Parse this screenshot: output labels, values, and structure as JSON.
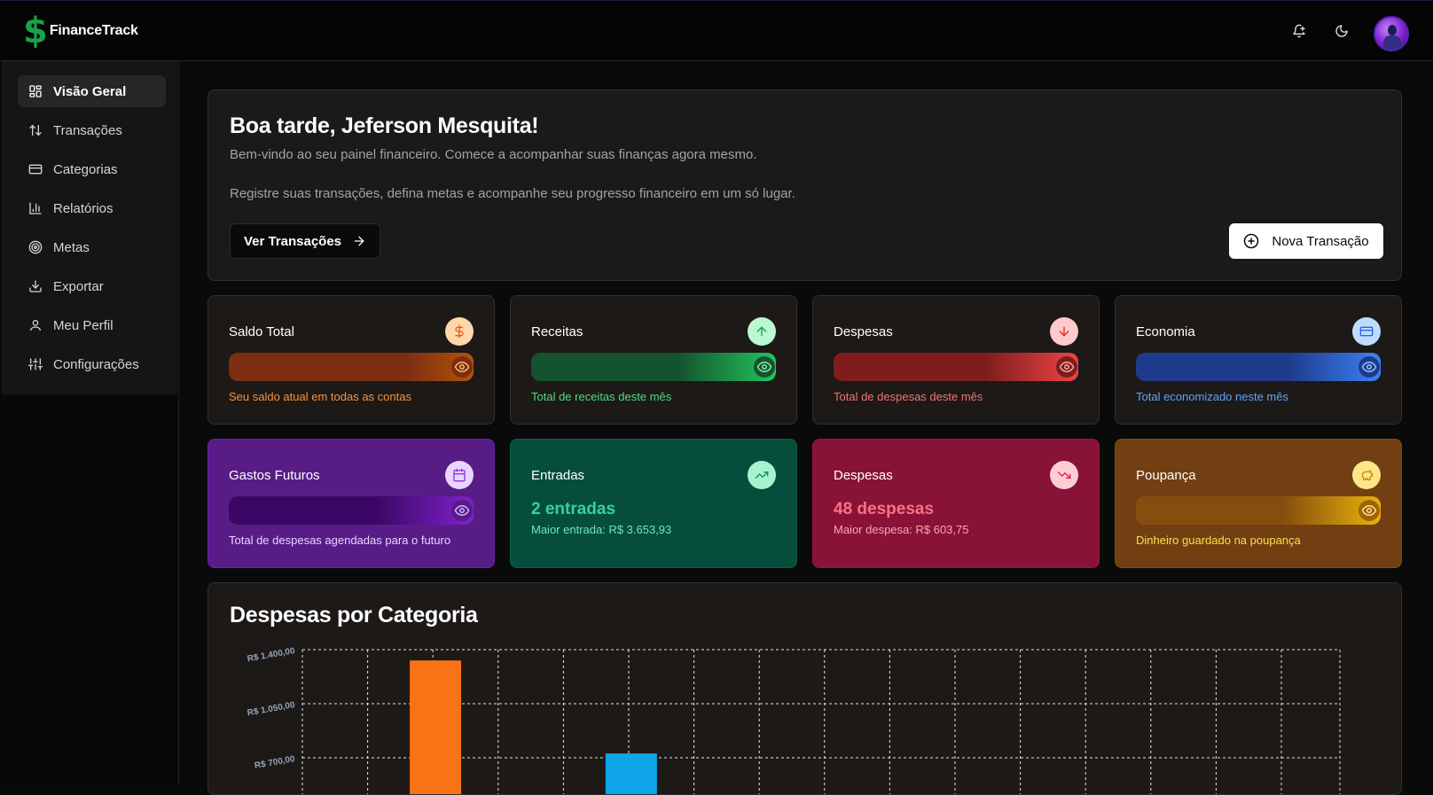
{
  "app": {
    "logo_symbol": "$",
    "name": "FinanceTrack",
    "brand_color": "#16a34a"
  },
  "topbar": {
    "icons": [
      "bell-plus-icon",
      "moon-icon"
    ],
    "avatar": "user-avatar"
  },
  "sidebar": {
    "items": [
      {
        "label": "Visão Geral",
        "icon": "dashboard-icon",
        "active": true
      },
      {
        "label": "Transações",
        "icon": "arrows-up-down-icon",
        "active": false
      },
      {
        "label": "Categorias",
        "icon": "card-icon",
        "active": false
      },
      {
        "label": "Relatórios",
        "icon": "bar-chart-icon",
        "active": false
      },
      {
        "label": "Metas",
        "icon": "target-icon",
        "active": false
      },
      {
        "label": "Exportar",
        "icon": "download-icon",
        "active": false
      },
      {
        "label": "Meu Perfil",
        "icon": "user-icon",
        "active": false
      },
      {
        "label": "Configurações",
        "icon": "sliders-icon",
        "active": false
      }
    ]
  },
  "hero": {
    "greeting": "Boa tarde, Jeferson Mesquita!",
    "line1": "Bem-vindo ao seu painel financeiro. Comece a acompanhar suas finanças agora mesmo.",
    "line2": "Registre suas transações, defina metas e acompanhe seu progresso financeiro em um só lugar.",
    "primary_button": "Ver Transações",
    "secondary_button": "Nova Transação"
  },
  "cards_row1": [
    {
      "title": "Saldo Total",
      "icon": "dollar-icon",
      "desc": "Seu saldo atual em todas as contas"
    },
    {
      "title": "Receitas",
      "icon": "arrow-up-icon",
      "desc": "Total de receitas deste mês"
    },
    {
      "title": "Despesas",
      "icon": "arrow-down-icon",
      "desc": "Total de despesas deste mês"
    },
    {
      "title": "Economia",
      "icon": "credit-card-icon",
      "desc": "Total economizado neste mês"
    }
  ],
  "cards_row2": [
    {
      "title": "Gastos Futuros",
      "icon": "calendar-icon",
      "desc": "Total de despesas agendadas para o futuro"
    },
    {
      "title": "Entradas",
      "icon": "trending-up-icon",
      "big": "2 entradas",
      "sub": "Maior entrada: R$ 3.653,93"
    },
    {
      "title": "Despesas",
      "icon": "trending-down-icon",
      "big": "48 despesas",
      "sub": "Maior despesa: R$ 603,75"
    },
    {
      "title": "Poupança",
      "icon": "piggy-bank-icon",
      "desc": "Dinheiro guardado na poupança"
    }
  ],
  "chart_section": {
    "title": "Despesas por Categoria"
  },
  "chart_data": {
    "type": "bar",
    "y_ticks": [
      "R$ 1.400,00",
      "R$ 1.050,00",
      "R$ 700,00"
    ],
    "ylim": [
      0,
      1400
    ],
    "grid": true,
    "bars": [
      {
        "value": 1330,
        "color": "#f97316",
        "slot": 2
      },
      {
        "value": 728,
        "color": "#0ea5e9",
        "slot": 5
      }
    ]
  }
}
